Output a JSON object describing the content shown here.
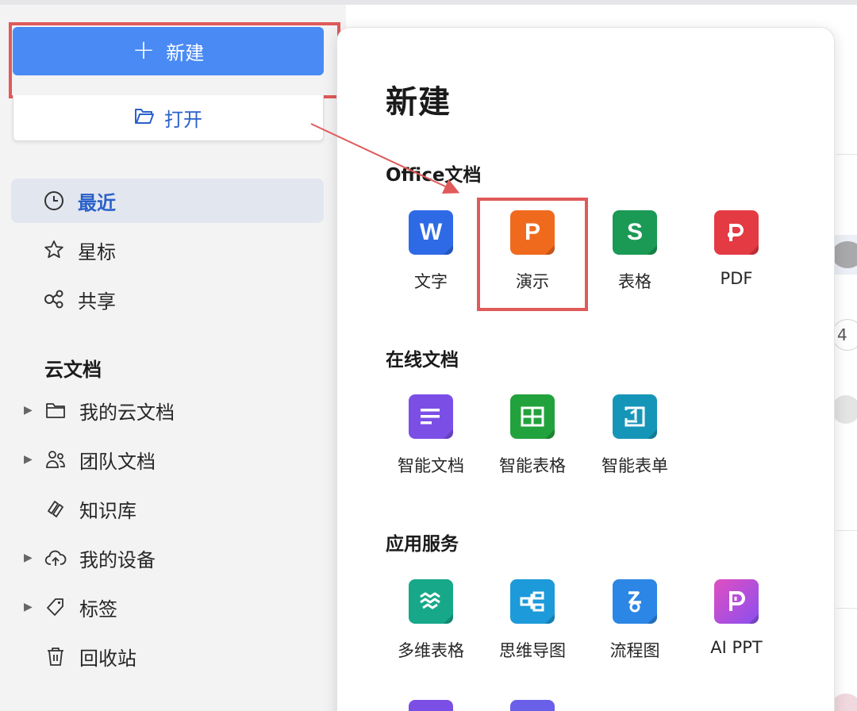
{
  "sidebar": {
    "new_label": "新建",
    "open_label": "打开",
    "nav": [
      {
        "label": "最近",
        "icon": "clock-icon"
      },
      {
        "label": "星标",
        "icon": "star-icon"
      },
      {
        "label": "共享",
        "icon": "share-icon"
      }
    ],
    "cloud_title": "云文档",
    "tree": [
      {
        "label": "我的云文档",
        "icon": "folder-icon",
        "expandable": true
      },
      {
        "label": "团队文档",
        "icon": "team-icon",
        "expandable": true
      },
      {
        "label": "知识库",
        "icon": "knowledge-icon",
        "expandable": false
      },
      {
        "label": "我的设备",
        "icon": "cloud-upload-icon",
        "expandable": true
      },
      {
        "label": "标签",
        "icon": "tag-icon",
        "expandable": true
      },
      {
        "label": "回收站",
        "icon": "trash-icon",
        "expandable": false
      }
    ]
  },
  "panel": {
    "title": "新建",
    "groups": [
      {
        "title": "Office文档",
        "items": [
          {
            "label": "文字",
            "glyph": "W",
            "color": "#2f6ae6"
          },
          {
            "label": "演示",
            "glyph": "P",
            "color": "#f06a1d"
          },
          {
            "label": "表格",
            "glyph": "S",
            "color": "#1a9a55"
          },
          {
            "label": "PDF",
            "glyph": "pdf",
            "color": "#e43a44"
          }
        ]
      },
      {
        "title": "在线文档",
        "items": [
          {
            "label": "智能文档",
            "glyph": "doc-lines",
            "color": "#7b4fe6"
          },
          {
            "label": "智能表格",
            "glyph": "grid",
            "color": "#22a23c"
          },
          {
            "label": "智能表单",
            "glyph": "form",
            "color": "#1596b8"
          }
        ]
      },
      {
        "title": "应用服务",
        "items": [
          {
            "label": "多维表格",
            "glyph": "multi-table",
            "color": "#16a889"
          },
          {
            "label": "思维导图",
            "glyph": "mind-map",
            "color": "#1d9ad9"
          },
          {
            "label": "流程图",
            "glyph": "flow",
            "color": "#2b86e5"
          },
          {
            "label": "AI PPT",
            "glyph": "ai-p",
            "color": "#c94ee0"
          }
        ]
      }
    ]
  },
  "edge": {
    "badge_number": "4"
  },
  "colors": {
    "accent": "#4a8af4",
    "highlight": "#e05a5a",
    "active_text": "#2a61c9"
  }
}
